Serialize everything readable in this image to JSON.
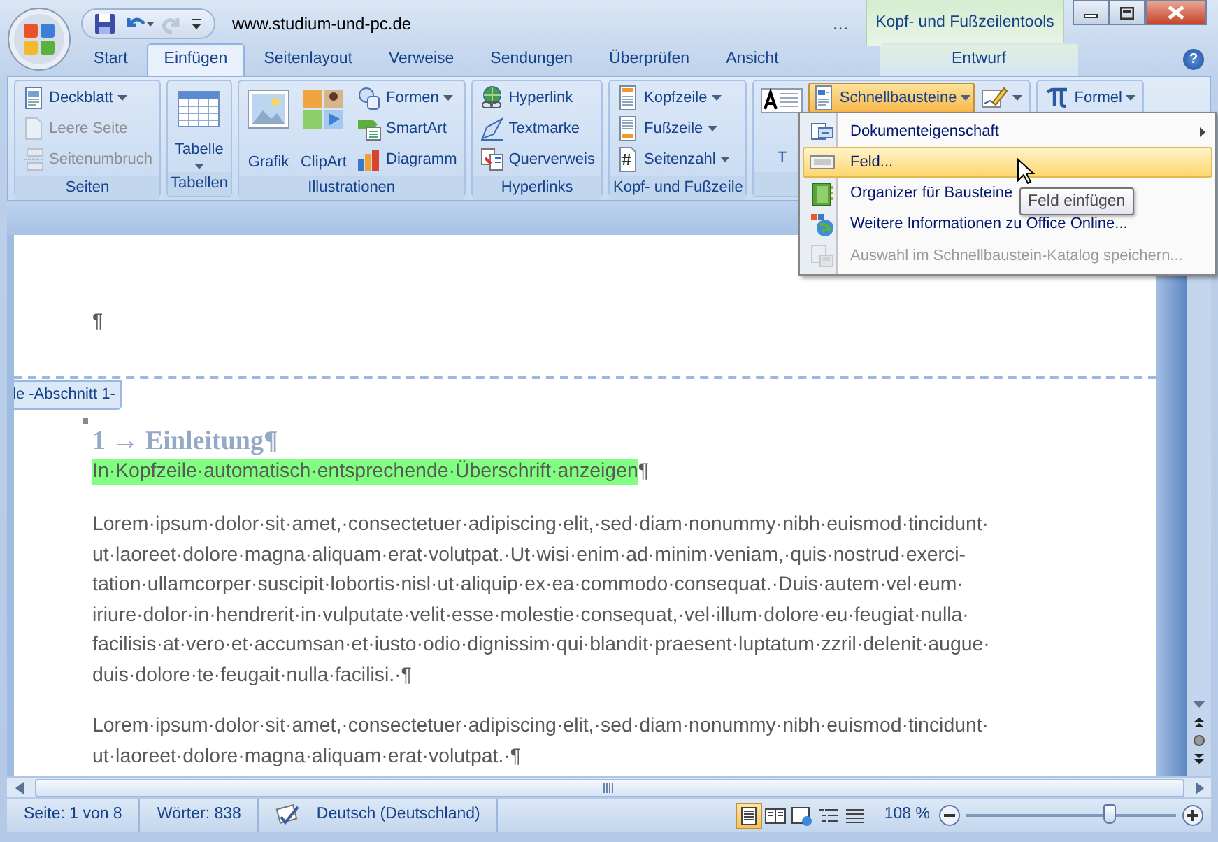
{
  "title_bar": {
    "quick_access": [
      {
        "kind": "save",
        "disabled": false
      },
      {
        "kind": "undo",
        "disabled": false
      },
      {
        "kind": "redo",
        "disabled": true
      },
      {
        "kind": "customize",
        "disabled": false
      }
    ],
    "title": "www.studium-und-pc.de",
    "title_rest": "…",
    "context_label": "Kopf- und Fußzeilentools"
  },
  "tabs": [
    {
      "label": "Start",
      "selected": false,
      "contextual": false
    },
    {
      "label": "Einfügen",
      "selected": true,
      "contextual": false
    },
    {
      "label": "Seitenlayout",
      "selected": false,
      "contextual": false
    },
    {
      "label": "Verweise",
      "selected": false,
      "contextual": false
    },
    {
      "label": "Sendungen",
      "selected": false,
      "contextual": false
    },
    {
      "label": "Überprüfen",
      "selected": false,
      "contextual": false
    },
    {
      "label": "Ansicht",
      "selected": false,
      "contextual": false
    },
    {
      "label": "Entwurf",
      "selected": false,
      "contextual": true
    }
  ],
  "help": "?",
  "ribbon_groups": [
    {
      "label": "Seiten",
      "items": [
        {
          "kind": "small",
          "label": "Deckblatt",
          "dropdown": true,
          "disabled": false
        },
        {
          "kind": "small",
          "label": "Leere Seite",
          "dropdown": false,
          "disabled": true
        },
        {
          "kind": "small",
          "label": "Seitenumbruch",
          "dropdown": false,
          "disabled": true
        }
      ]
    },
    {
      "label": "Tabellen",
      "items": [
        {
          "kind": "large",
          "label": "Tabelle",
          "dropdown": true,
          "disabled": false
        }
      ]
    },
    {
      "label": "Illustrationen",
      "items": [
        {
          "kind": "large",
          "label": "Grafik",
          "dropdown": false,
          "disabled": false
        },
        {
          "kind": "large",
          "label": "ClipArt",
          "dropdown": false,
          "disabled": false
        },
        {
          "kind": "small",
          "label": "Formen",
          "dropdown": true,
          "disabled": false
        },
        {
          "kind": "small",
          "label": "SmartArt",
          "dropdown": false,
          "disabled": false
        },
        {
          "kind": "small",
          "label": "Diagramm",
          "dropdown": false,
          "disabled": false
        }
      ]
    },
    {
      "label": "Hyperlinks",
      "items": [
        {
          "kind": "small",
          "label": "Hyperlink",
          "dropdown": false,
          "disabled": false
        },
        {
          "kind": "small",
          "label": "Textmarke",
          "dropdown": false,
          "disabled": false
        },
        {
          "kind": "small",
          "label": "Querverweis",
          "dropdown": false,
          "disabled": false
        }
      ]
    },
    {
      "label": "Kopf- und Fußzeile",
      "items": [
        {
          "kind": "small",
          "label": "Kopfzeile",
          "dropdown": true,
          "disabled": false
        },
        {
          "kind": "small",
          "label": "Fußzeile",
          "dropdown": true,
          "disabled": false
        },
        {
          "kind": "small",
          "label": "Seitenzahl",
          "dropdown": true,
          "disabled": false
        }
      ]
    },
    {
      "items": [
        {
          "kind": "large",
          "label": "T",
          "dropdown": false,
          "disabled": false
        },
        {
          "kind": "small",
          "label": "Schnellbausteine",
          "dropdown": true,
          "disabled": false,
          "expanded": true
        },
        {
          "kind": "small",
          "dropdown": true,
          "disabled": false,
          "expanded": false
        }
      ]
    },
    {
      "items": [
        {
          "kind": "small",
          "label": "Formel",
          "dropdown": true,
          "disabled": false
        }
      ]
    }
  ],
  "menu": {
    "items": [
      {
        "label": "Dokumenteigenschaft",
        "submenu": true,
        "selected": false,
        "disabled": false
      },
      {
        "label": "Feld...",
        "submenu": false,
        "selected": true,
        "disabled": false
      },
      {
        "label": "Organizer für Bausteine",
        "submenu": false,
        "selected": false,
        "disabled": false
      },
      {
        "label": "Weitere Informationen zu Office Online...",
        "submenu": false,
        "selected": false,
        "disabled": false
      },
      {
        "label": "Auswahl im Schnellbaustein-Katalog speichern...",
        "submenu": false,
        "selected": false,
        "disabled": true
      }
    ]
  },
  "tooltip": "Feld einfügen",
  "document": {
    "paragraph_mark": "¶",
    "section_label": "le -Abschnitt 1-",
    "heading": "1 → Einleitung¶",
    "highlight_line": {
      "text": "In·Kopfzeile·automatisch·entsprechende·Überschrift·anzeigen",
      "highlighted": true,
      "end_mark": "¶"
    },
    "paragraphs": [
      {
        "lines": [
          "Lorem·ipsum·dolor·sit·amet,·consectetuer·adipiscing·elit,·sed·diam·nonummy·nibh·euismod·tincidunt·",
          "ut·laoreet·dolore·magna·aliquam·erat·volutpat.·Ut·wisi·enim·ad·minim·veniam,·quis·nostrud·exerci-",
          "tation·ullamcorper·suscipit·lobortis·nisl·ut·aliquip·ex·ea·commodo·consequat.·Duis·autem·vel·eum·",
          "iriure·dolor·in·hendrerit·in·vulputate·velit·esse·molestie·consequat,·vel·illum·dolore·eu·feugiat·nulla·",
          "facilisis·at·vero·et·accumsan·et·iusto·odio·dignissim·qui·blandit·praesent·luptatum·zzril·delenit·augue·",
          "duis·dolore·te·feugait·nulla·facilisi.·¶"
        ]
      },
      {
        "lines": [
          "Lorem·ipsum·dolor·sit·amet,·consectetuer·adipiscing·elit,·sed·diam·nonummy·nibh·euismod·tincidunt·",
          "ut·laoreet·dolore·magna·aliquam·erat·volutpat.·¶"
        ]
      }
    ]
  },
  "status_bar": {
    "page": "Seite: 1 von 8",
    "words": "Wörter: 838",
    "language": "Deutsch (Deutschland)",
    "views": [
      {
        "kind": "print",
        "selected": true
      },
      {
        "kind": "reading",
        "selected": false
      },
      {
        "kind": "web",
        "selected": false
      },
      {
        "kind": "outline",
        "selected": false
      },
      {
        "kind": "draft",
        "selected": false
      }
    ],
    "zoom": "108 %",
    "zoom_slider": {
      "level": 0.68
    }
  }
}
